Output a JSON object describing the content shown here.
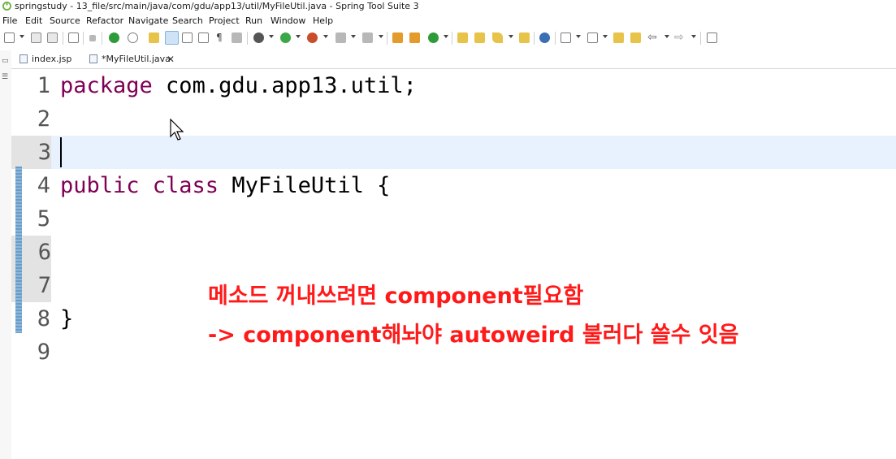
{
  "window": {
    "title": "springstudy - 13_file/src/main/java/com/gdu/app13/util/MyFileUtil.java - Spring Tool Suite 3"
  },
  "menu": [
    "File",
    "Edit",
    "Source",
    "Refactor",
    "Navigate",
    "Search",
    "Project",
    "Run",
    "Window",
    "Help"
  ],
  "tabs": [
    {
      "label": "index.jsp",
      "icon": "jsp-file-icon"
    },
    {
      "label": "*MyFileUtil.java",
      "icon": "java-file-icon",
      "close": "✕"
    }
  ],
  "editor": {
    "lines": [
      {
        "num": "1",
        "kw": "package",
        "rest": " com.gdu.app13.util;"
      },
      {
        "num": "2",
        "kw": "",
        "rest": ""
      },
      {
        "num": "3",
        "kw": "",
        "rest": ""
      },
      {
        "num": "4",
        "kw": "public class",
        "rest": " MyFileUtil {"
      },
      {
        "num": "5",
        "kw": "",
        "rest": ""
      },
      {
        "num": "6",
        "kw": "",
        "rest": ""
      },
      {
        "num": "7",
        "kw": "",
        "rest": ""
      },
      {
        "num": "8",
        "kw": "",
        "rest": "}"
      },
      {
        "num": "9",
        "kw": "",
        "rest": ""
      }
    ],
    "current_line": "3"
  },
  "annotation": {
    "line1": "메소드 꺼내쓰려면 component필요함",
    "line2": "-> component해놔야 autoweird 불러다 쓸수 잇음",
    "color": "#ff1a1a"
  },
  "colors": {
    "keyword": "#7f0055",
    "current_line_bg": "#e8f2fe"
  }
}
